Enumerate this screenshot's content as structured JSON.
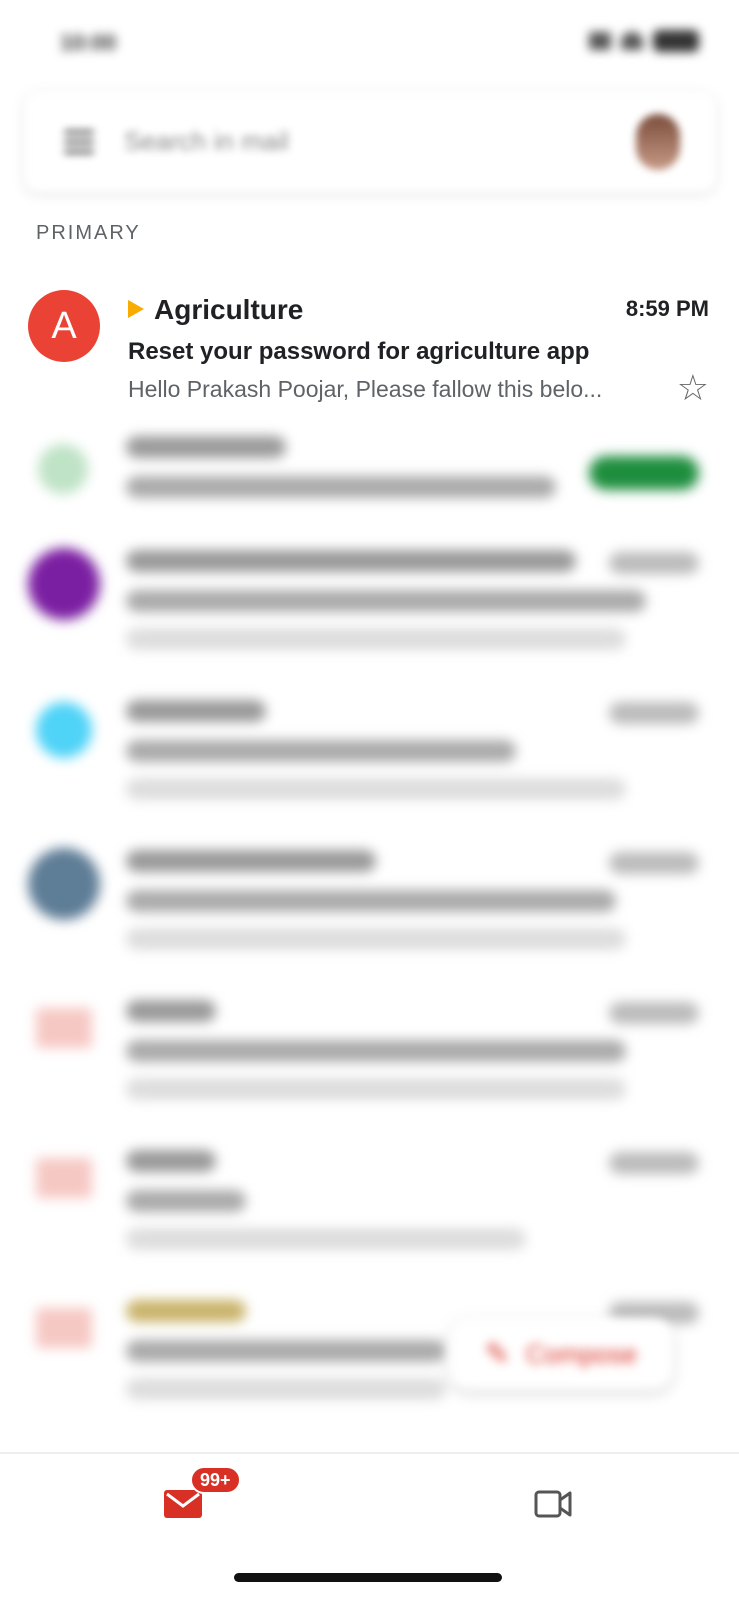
{
  "status_bar": {
    "time": "10:00"
  },
  "search": {
    "placeholder": "Search in mail"
  },
  "section": {
    "label": "PRIMARY"
  },
  "emails": [
    {
      "sender": "Agriculture",
      "time": "8:59 PM",
      "subject": "Reset your password for agriculture app",
      "snippet": "Hello Prakash Poojar, Please fallow this belo...",
      "avatar_letter": "A",
      "avatar_color": "#ea4335",
      "important_label_color": "#f9ab00"
    }
  ],
  "compose": {
    "label": "Compose"
  },
  "bottom_nav": {
    "mail_badge": "99+"
  },
  "colors": {
    "accent": "#d93025",
    "promo_green": "#1e8e3e"
  }
}
